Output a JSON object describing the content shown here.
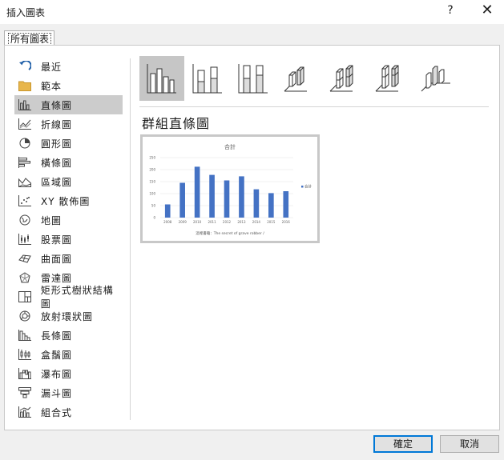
{
  "window": {
    "title": "插入圖表",
    "help_label": "?",
    "close_label": "✕"
  },
  "tab": {
    "label": "所有圖表"
  },
  "sidebar": {
    "items": [
      {
        "label": "最近",
        "icon": "recent-icon"
      },
      {
        "label": "範本",
        "icon": "folder-icon"
      },
      {
        "label": "直條圖",
        "icon": "column-chart-icon"
      },
      {
        "label": "折線圖",
        "icon": "line-chart-icon"
      },
      {
        "label": "圓形圖",
        "icon": "pie-chart-icon"
      },
      {
        "label": "橫條圖",
        "icon": "bar-chart-icon"
      },
      {
        "label": "區域圖",
        "icon": "area-chart-icon"
      },
      {
        "label": "XY 散佈圖",
        "icon": "scatter-chart-icon"
      },
      {
        "label": "地圖",
        "icon": "map-chart-icon"
      },
      {
        "label": "股票圖",
        "icon": "stock-chart-icon"
      },
      {
        "label": "曲面圖",
        "icon": "surface-chart-icon"
      },
      {
        "label": "雷達圖",
        "icon": "radar-chart-icon"
      },
      {
        "label": "矩形式樹狀結構圖",
        "icon": "treemap-chart-icon"
      },
      {
        "label": "放射環狀圖",
        "icon": "sunburst-chart-icon"
      },
      {
        "label": "長條圖",
        "icon": "histogram-chart-icon"
      },
      {
        "label": "盒鬚圖",
        "icon": "box-whisker-chart-icon"
      },
      {
        "label": "瀑布圖",
        "icon": "waterfall-chart-icon"
      },
      {
        "label": "漏斗圖",
        "icon": "funnel-chart-icon"
      },
      {
        "label": "組合式",
        "icon": "combo-chart-icon"
      }
    ],
    "selected_index": 2
  },
  "subtypes": [
    "clustered-column-icon",
    "stacked-column-icon",
    "100-stacked-column-icon",
    "3d-clustered-column-icon",
    "3d-stacked-column-icon",
    "3d-100-stacked-column-icon",
    "3d-column-icon"
  ],
  "selected_type_title": "群組直條圖",
  "chart_data": {
    "type": "bar",
    "title": "合計",
    "categories": [
      "2008",
      "2009",
      "2010",
      "2011",
      "2012",
      "2013",
      "2014",
      "2015",
      "2016"
    ],
    "series": [
      {
        "name": "合計",
        "values": [
          55,
          145,
          212,
          178,
          155,
          172,
          118,
          102,
          110
        ],
        "color": "#4472c4"
      }
    ],
    "ylim": [
      0,
      250
    ],
    "yticks": [
      "0",
      "50",
      "100",
      "150",
      "200",
      "250"
    ],
    "xlabel": "這裡書籍：The secret of grave robber /",
    "grid": true,
    "legend": "right"
  },
  "buttons": {
    "ok": "確定",
    "cancel": "取消"
  }
}
